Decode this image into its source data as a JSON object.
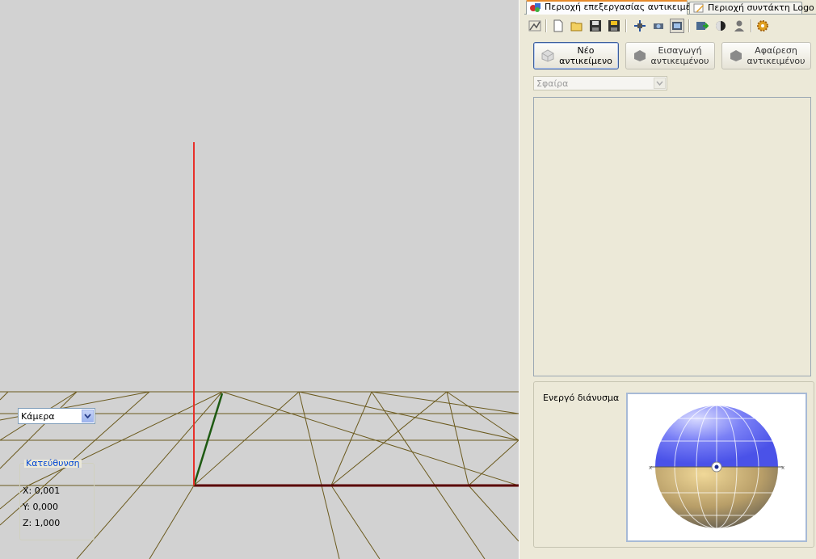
{
  "tabs": {
    "objects": "Περιοχή επεξεργασίας αντικειμένων",
    "logo_editor": "Περιοχή συντάκτη Logo"
  },
  "toolbar": {
    "icons": [
      "path-icon",
      "new-file-icon",
      "open-folder-icon",
      "save-icon",
      "save-as-icon",
      "move-icon",
      "camera-view-icon",
      "screen-view-icon",
      "export-icon",
      "shading-icon",
      "user-icon",
      "settings-icon"
    ]
  },
  "buttons": {
    "new_object": "Νέο αντικείμενο",
    "import_object": "Εισαγωγή αντικειμένου",
    "remove_objects": "Αφαίρεση αντικειμένου"
  },
  "shape_select": {
    "value": "Σφαίρα"
  },
  "vector": {
    "label": "Ενεργό διάνυσμα",
    "value": "Κάμερα"
  },
  "direction": {
    "legend": "Κατεύθυνση",
    "x": "X: 0,001",
    "y": "Y: 0,000",
    "z": "Z: 1,000"
  },
  "colors": {
    "axis_vertical": "#e8302a",
    "axis_horizontal": "#5a0000",
    "axis_depth": "#1e5a12",
    "grid": "#6b5a1e",
    "sphere_top": "#5b63f2",
    "sphere_bottom": "#c9a860"
  }
}
